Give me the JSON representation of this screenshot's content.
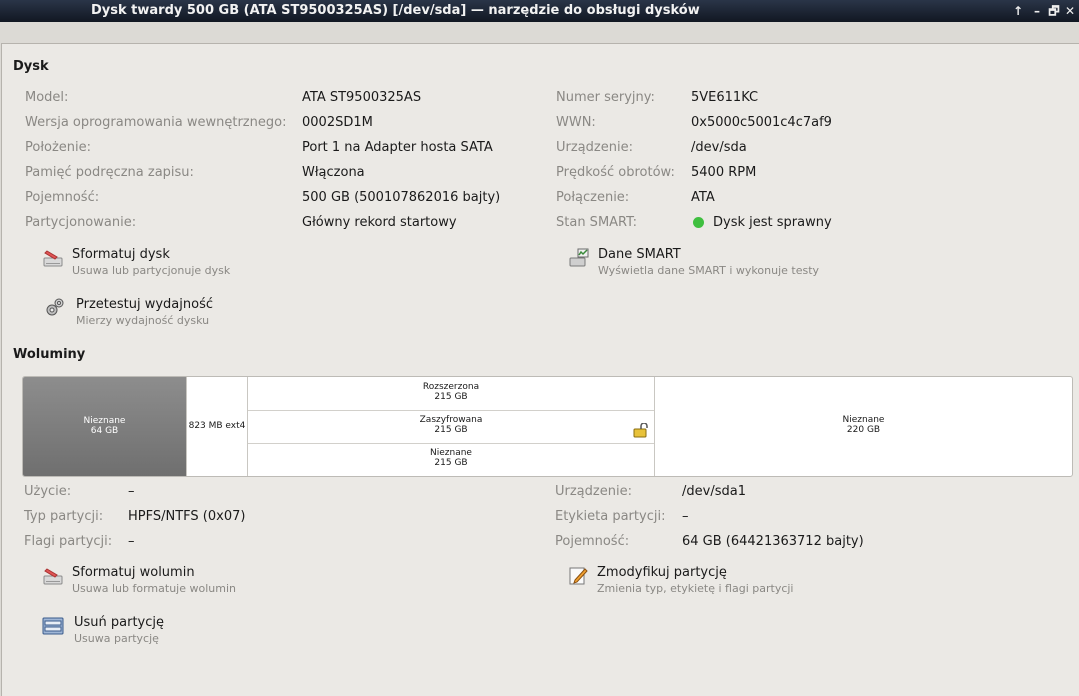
{
  "window": {
    "title": "Dysk twardy 500 GB (ATA ST9500325AS) [/dev/sda] — narzędzie do obsługi dysków",
    "controls": [
      "↑",
      "–",
      "🗗",
      "✕"
    ]
  },
  "disk": {
    "section_title": "Dysk",
    "left": [
      {
        "label": "Model:",
        "value": "ATA ST9500325AS"
      },
      {
        "label": "Wersja oprogramowania wewnętrznego:",
        "value": "0002SD1M"
      },
      {
        "label": "Położenie:",
        "value": "Port 1 na Adapter hosta SATA"
      },
      {
        "label": "Pamięć podręczna zapisu:",
        "value": "Włączona"
      },
      {
        "label": "Pojemność:",
        "value": "500 GB (500107862016 bajty)"
      },
      {
        "label": "Partycjonowanie:",
        "value": "Główny rekord startowy"
      }
    ],
    "right": [
      {
        "label": "Numer seryjny:",
        "value": "5VE611KC"
      },
      {
        "label": "WWN:",
        "value": "0x5000c5001c4c7af9"
      },
      {
        "label": "Urządzenie:",
        "value": "/dev/sda"
      },
      {
        "label": "Prędkość obrotów:",
        "value": "5400 RPM"
      },
      {
        "label": "Połączenie:",
        "value": "ATA"
      },
      {
        "label": "Stan SMART:",
        "value": "Dysk jest sprawny"
      }
    ],
    "actions": {
      "format": {
        "title": "Sformatuj dysk",
        "desc": "Usuwa lub partycjonuje dysk"
      },
      "smart": {
        "title": "Dane SMART",
        "desc": "Wyświetla dane SMART i wykonuje testy"
      },
      "benchmark": {
        "title": "Przetestuj wydajność",
        "desc": "Mierzy wydajność dysku"
      }
    }
  },
  "volumes": {
    "section_title": "Woluminy",
    "segments": {
      "unknown1": {
        "name": "Nieznane",
        "size": "64 GB"
      },
      "ext4": {
        "label": "823 MB ext4"
      },
      "extended": {
        "name": "Rozszerzona",
        "size": "215 GB"
      },
      "encrypted": {
        "name": "Zaszyfrowana",
        "size": "215 GB"
      },
      "unknown_inner": {
        "name": "Nieznane",
        "size": "215 GB"
      },
      "unknown2": {
        "name": "Nieznane",
        "size": "220 GB"
      }
    },
    "left": [
      {
        "label": "Użycie:",
        "value": "–"
      },
      {
        "label": "Typ partycji:",
        "value": "HPFS/NTFS (0x07)"
      },
      {
        "label": "Flagi partycji:",
        "value": "–"
      }
    ],
    "right": [
      {
        "label": "Urządzenie:",
        "value": "/dev/sda1"
      },
      {
        "label": "Etykieta partycji:",
        "value": "–"
      },
      {
        "label": "Pojemność:",
        "value": "64 GB (64421363712 bajty)"
      }
    ],
    "actions": {
      "format_volume": {
        "title": "Sformatuj wolumin",
        "desc": "Usuwa lub formatuje wolumin"
      },
      "modify": {
        "title": "Zmodyfikuj partycję",
        "desc": "Zmienia typ, etykietę i flagi partycji"
      },
      "delete": {
        "title": "Usuń partycję",
        "desc": "Usuwa partycję"
      }
    }
  },
  "colors": {
    "selected_segment": "#7a7a7a",
    "smart_ok": "#3fbf3f"
  }
}
